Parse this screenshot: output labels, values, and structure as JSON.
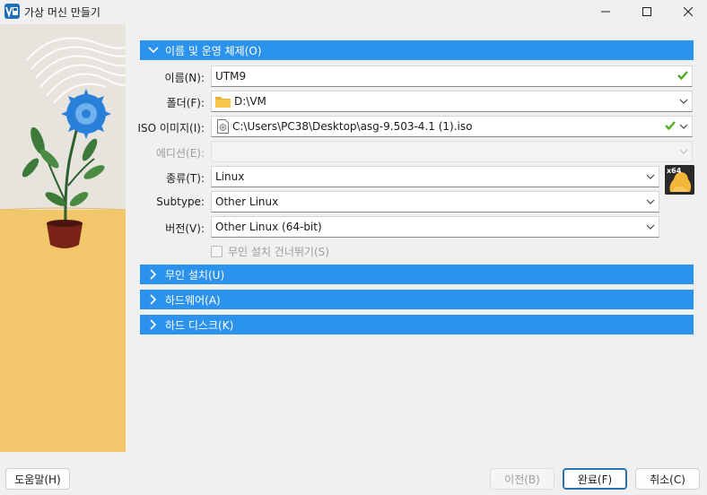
{
  "window": {
    "title": "가상 머신 만들기",
    "icon": "virtualbox-icon"
  },
  "sections": {
    "name_os": {
      "label": "이름 및 운영 체제(O)",
      "expanded": true
    },
    "unattended": {
      "label": "무인 설치(U)",
      "expanded": false
    },
    "hardware": {
      "label": "하드웨어(A)",
      "expanded": false
    },
    "hard_disk": {
      "label": "하드 디스크(K)",
      "expanded": false
    }
  },
  "form": {
    "name": {
      "label": "이름(N):",
      "value": "UTM9",
      "valid": true
    },
    "folder": {
      "label": "폴더(F):",
      "value": "D:\\VM"
    },
    "iso": {
      "label": "ISO 이미지(I):",
      "value": "C:\\Users\\PC38\\Desktop\\asg-9.503-4.1 (1).iso",
      "valid": true
    },
    "edition": {
      "label": "에디션(E):",
      "value": "",
      "disabled": true
    },
    "type": {
      "label": "종류(T):",
      "value": "Linux"
    },
    "subtype": {
      "label": "Subtype:",
      "value": "Other Linux"
    },
    "version": {
      "label": "버전(V):",
      "value": "Other Linux (64-bit)"
    },
    "skip_unattended": {
      "label": "무인 설치 건너뛰기(S)",
      "checked": false,
      "disabled": true
    }
  },
  "os_icon": {
    "badge": "x64",
    "name": "linux-tux-icon"
  },
  "buttons": {
    "help": "도움말(H)",
    "back": "이전(B)",
    "finish": "완료(F)",
    "cancel": "취소(C)"
  },
  "colors": {
    "section_header": "#2b92ee",
    "valid_check": "#4caf20"
  }
}
